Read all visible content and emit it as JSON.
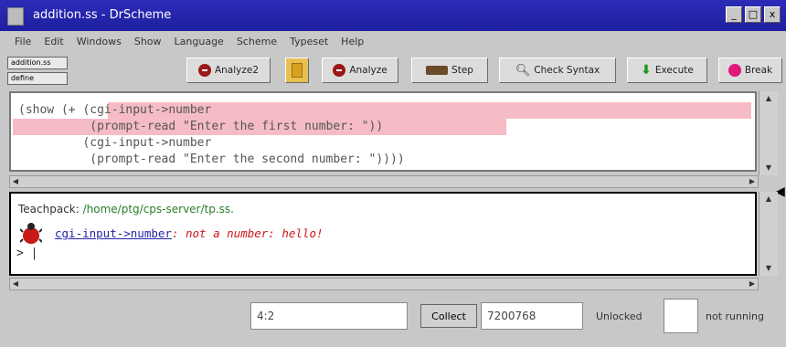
{
  "window": {
    "title": "addition.ss - DrScheme"
  },
  "menu": [
    "File",
    "Edit",
    "Windows",
    "Show",
    "Language",
    "Scheme",
    "Typeset",
    "Help"
  ],
  "selectors": [
    "addition.ss",
    "define"
  ],
  "toolbar": {
    "analyze2": "Analyze2",
    "analyze": "Analyze",
    "step": "Step",
    "check_syntax": "Check Syntax",
    "execute": "Execute",
    "break": "Break"
  },
  "definitions": {
    "lines": [
      "(show (+ (cgi-input->number",
      "          (prompt-read \"Enter the first number: \"))",
      "         (cgi-input->number",
      "          (prompt-read \"Enter the second number: \"))))"
    ]
  },
  "interactions": {
    "teachpack_label": "Teachpack: ",
    "teachpack_path": "/home/ptg/cps-server/tp.ss.",
    "error_link": "cgi-input->number",
    "error_message": ": not a number: hello!",
    "prompt": "> |"
  },
  "status": {
    "position": "4:2",
    "collect": "Collect",
    "memory": "7200768",
    "lock": "Unlocked",
    "running": "not running"
  },
  "colors": {
    "title_bar": "#1f1fa0",
    "highlight": "#f6bcc6",
    "error": "#d01515"
  }
}
